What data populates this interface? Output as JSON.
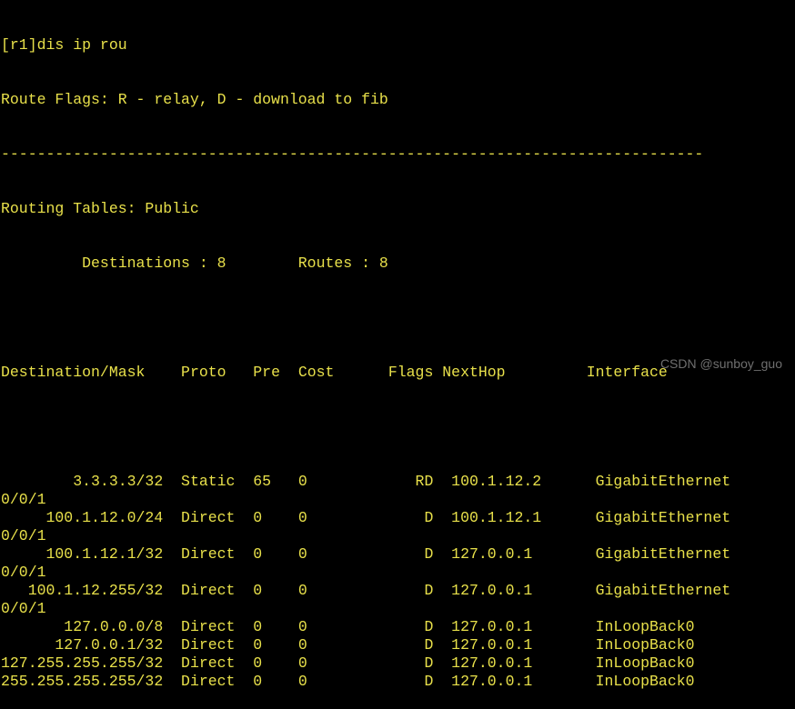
{
  "terminal": {
    "prompt_line": "[r1]dis ip rou",
    "flags_line": "Route Flags: R - relay, D - download to fib",
    "separator": "------------------------------------------------------------------------------",
    "tables_line": "Routing Tables: Public",
    "dest_label": "Destinations : 8",
    "routes_label": "Routes : 8",
    "headers": {
      "destination": "Destination/Mask",
      "proto": "Proto",
      "pre": "Pre",
      "cost": "Cost",
      "flags": "Flags",
      "nexthop": "NextHop",
      "interface": "Interface"
    },
    "routes": [
      {
        "destination": "3.3.3.3/32",
        "proto": "Static",
        "pre": "65",
        "cost": "0",
        "flags": "RD",
        "nexthop": "100.1.12.2",
        "interface": "GigabitEthernet",
        "interface_cont": "0/0/1"
      },
      {
        "destination": "100.1.12.0/24",
        "proto": "Direct",
        "pre": "0",
        "cost": "0",
        "flags": "D",
        "nexthop": "100.1.12.1",
        "interface": "GigabitEthernet",
        "interface_cont": "0/0/1"
      },
      {
        "destination": "100.1.12.1/32",
        "proto": "Direct",
        "pre": "0",
        "cost": "0",
        "flags": "D",
        "nexthop": "127.0.0.1",
        "interface": "GigabitEthernet",
        "interface_cont": "0/0/1"
      },
      {
        "destination": "100.1.12.255/32",
        "proto": "Direct",
        "pre": "0",
        "cost": "0",
        "flags": "D",
        "nexthop": "127.0.0.1",
        "interface": "GigabitEthernet",
        "interface_cont": "0/0/1"
      },
      {
        "destination": "127.0.0.0/8",
        "proto": "Direct",
        "pre": "0",
        "cost": "0",
        "flags": "D",
        "nexthop": "127.0.0.1",
        "interface": "InLoopBack0"
      },
      {
        "destination": "127.0.0.1/32",
        "proto": "Direct",
        "pre": "0",
        "cost": "0",
        "flags": "D",
        "nexthop": "127.0.0.1",
        "interface": "InLoopBack0"
      },
      {
        "destination": "127.255.255.255/32",
        "proto": "Direct",
        "pre": "0",
        "cost": "0",
        "flags": "D",
        "nexthop": "127.0.0.1",
        "interface": "InLoopBack0"
      },
      {
        "destination": "255.255.255.255/32",
        "proto": "Direct",
        "pre": "0",
        "cost": "0",
        "flags": "D",
        "nexthop": "127.0.0.1",
        "interface": "InLoopBack0"
      }
    ]
  },
  "watermark": "CSDN @sunboy_guo",
  "colors": {
    "background": "#000000",
    "text": "#e8e04a"
  }
}
